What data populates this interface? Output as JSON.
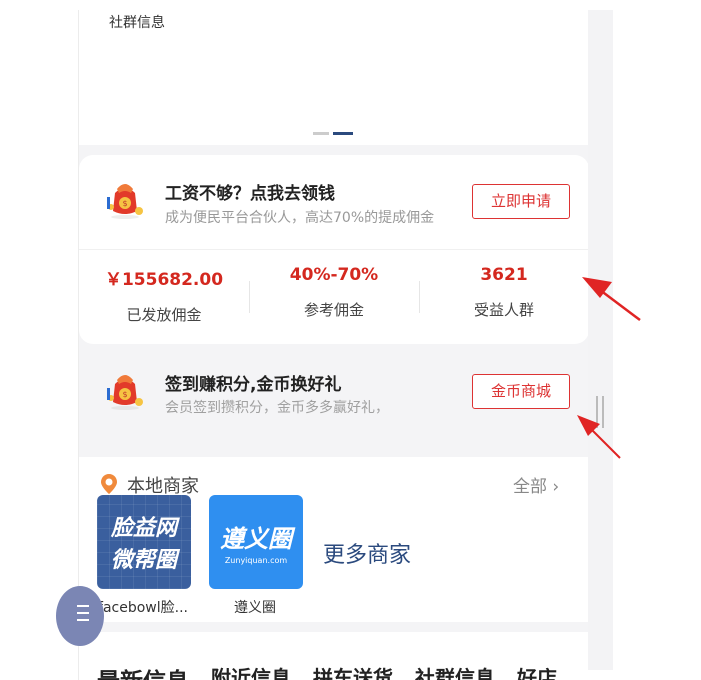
{
  "banner": {
    "label": "社群信息",
    "dots": 2
  },
  "promo1": {
    "title": "工资不够？点我去领钱",
    "subtitle": "成为便民平台合伙人，高达70%的提成佣金",
    "button": "立即申请"
  },
  "stats": [
    {
      "value": "￥155682.00",
      "label": "已发放佣金"
    },
    {
      "value": "40%-70%",
      "label": "参考佣金"
    },
    {
      "value": "3621",
      "label": "受益人群"
    }
  ],
  "promo2": {
    "title": "签到赚积分,金币换好礼",
    "subtitle": "会员签到攒积分，金币多多赢好礼，",
    "button": "金币商城"
  },
  "local": {
    "title": "本地商家",
    "all_link": "全部",
    "merchants": [
      {
        "name": "facebowl脸...",
        "logo_line1": "脸益网",
        "logo_line2": "微帮圈"
      },
      {
        "name": "遵义圈",
        "logo_line1": "遵义圈",
        "logo_line2": "Zunyiquan.com"
      }
    ],
    "more": "更多商家"
  },
  "tabs": [
    "最新信息",
    "附近信息",
    "拼车送货",
    "社群信息",
    "好店"
  ],
  "colors": {
    "accent_red": "#d4281f",
    "brand_blue": "#2b4a7e",
    "annotation_red": "#e02424"
  }
}
